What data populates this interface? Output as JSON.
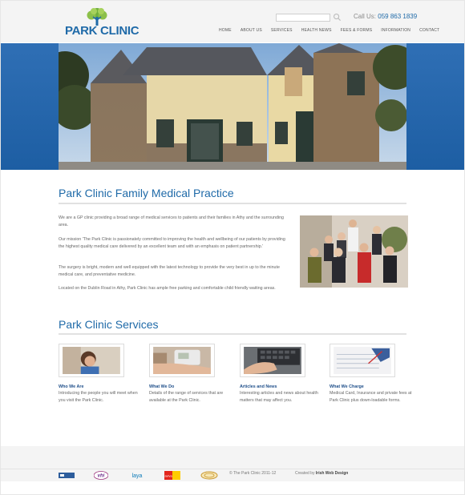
{
  "header": {
    "logo_text": "PARK CLINIC",
    "search": {
      "placeholder": "",
      "value": ""
    },
    "call_label": "Call Us:",
    "call_number": "059 863 1839",
    "nav": [
      "HOME",
      "ABOUT US",
      "SERVICES",
      "HEALTH NEWS",
      "FEES & FORMS",
      "INFORMATION",
      "CONTACT"
    ]
  },
  "main": {
    "title": "Park Clinic Family Medical Practice",
    "paragraphs": [
      "We are a GP clinic providing a broad range of medical services to patients and their families in Athy and the surrounding area.",
      "Our mission 'The Park Clinic is passionately committed to improving the health and wellbeing of our patients by providing the highest quality medical care delivered by an excellent team and with an emphasis on patient partnership.'",
      "The surgery is bright, modern and well equipped with the latest technology to provide the very best in up to the minute medical care, and preventative medicine.",
      "Located on the Dublin Road in Athy, Park Clinic has ample free parking and comfortable child friendly waiting areas."
    ],
    "services_title": "Park Clinic Services",
    "services": [
      {
        "title": "Who We Are",
        "desc": "Introducing the people you will meet when you visit the Park Clinic."
      },
      {
        "title": "What We Do",
        "desc": "Details of the range of services that are available at the Park Clinic."
      },
      {
        "title": "Articles and News",
        "desc": "Interesting articles and news about health matters that may affect you."
      },
      {
        "title": "What We Charge",
        "desc": "Medical Card, Insurance and private fees at Park Clinic plus down-loadable forms."
      }
    ]
  },
  "footer": {
    "partners": [
      "vhi",
      "laya",
      "aviva"
    ],
    "copyright": "© The Park Clinic 2011-12",
    "created_label": "Created by",
    "created_by": "Irish Web Design"
  },
  "colors": {
    "brand": "#1f6aa8",
    "hero_band": "#1d5ea3"
  }
}
